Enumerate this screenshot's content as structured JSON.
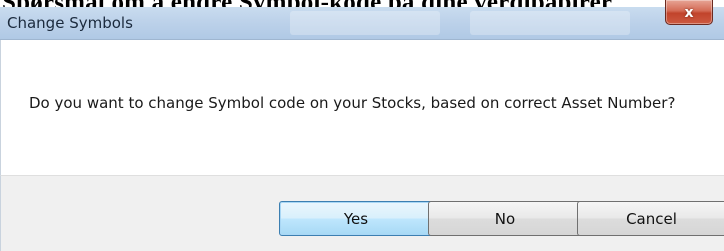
{
  "background": {
    "heading_text": "Spørsmål om å endre Symbol-kode på dine verdipapirer"
  },
  "dialog": {
    "title": "Change Symbols",
    "close_glyph": "x",
    "message": "Do you want to change Symbol code on your Stocks, based on correct Asset Number?",
    "buttons": {
      "yes_label": "Yes",
      "no_label": "No",
      "cancel_label": "Cancel"
    },
    "default_button": "yes"
  },
  "colors": {
    "titlebar": "#bdd2ea",
    "close_button": "#c1432b",
    "footer": "#f0f0f0",
    "default_button_border": "#3c7fb1"
  }
}
